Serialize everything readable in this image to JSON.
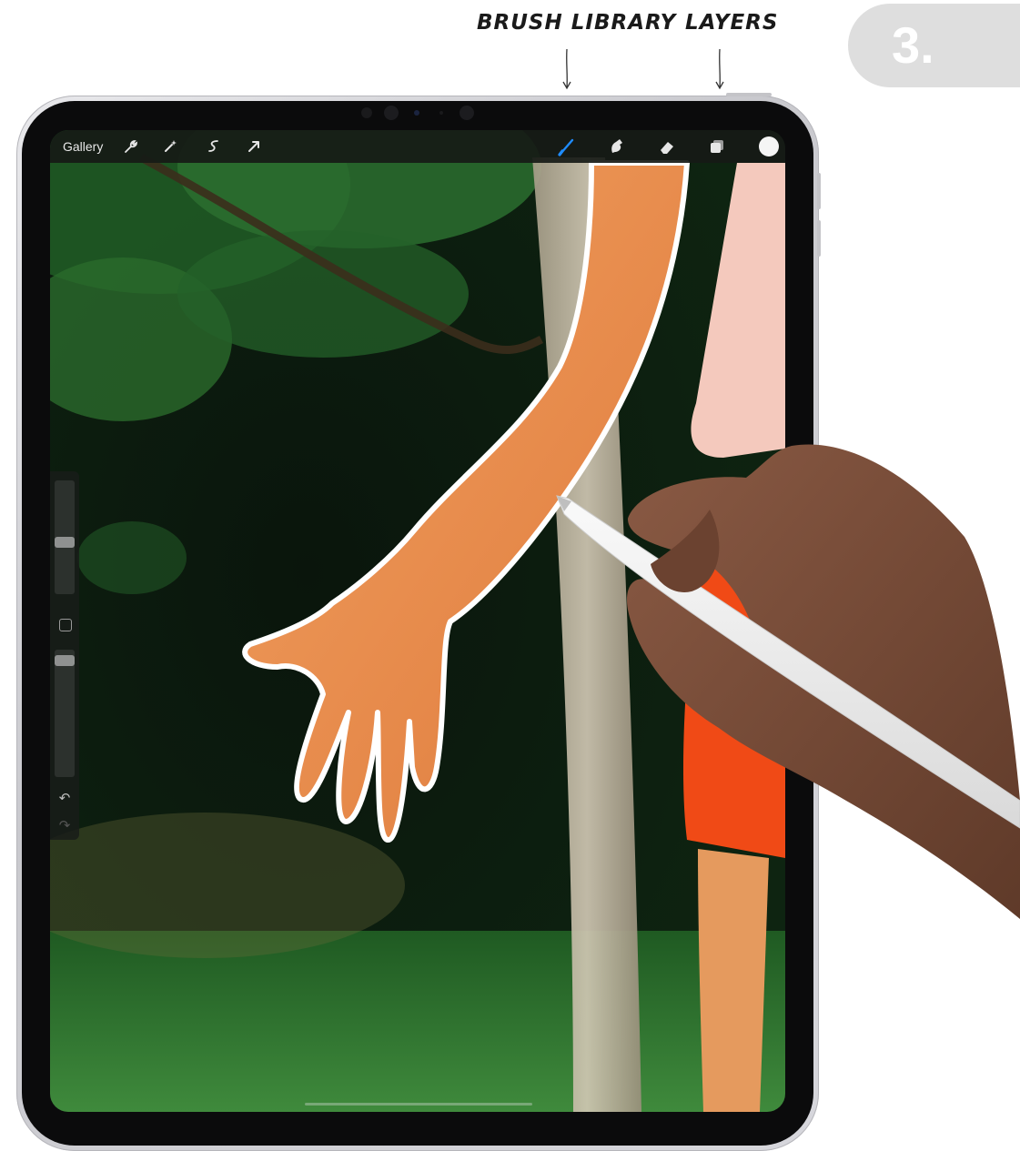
{
  "annotations": {
    "brush_library": "BRUSH LIBRARY",
    "layers": "LAYERS",
    "step_number": "3."
  },
  "toolbar": {
    "gallery_label": "Gallery",
    "left_tools": [
      "wrench-icon",
      "magic-wand-icon",
      "selection-icon",
      "transform-arrow-icon"
    ],
    "right_tools": [
      "brush-icon",
      "smudge-icon",
      "eraser-icon",
      "layers-icon"
    ],
    "active_tool": "brush-icon",
    "active_color": "#1f8cff",
    "current_color": "#f5f5f5"
  },
  "sidebar": {
    "brush_size_level": 0.45,
    "opacity_level": 0.95
  },
  "colors": {
    "outline": "#ffffff",
    "skin": "#e88a4a",
    "foliage": "#2f6b32",
    "shorts": "#f04a16"
  }
}
